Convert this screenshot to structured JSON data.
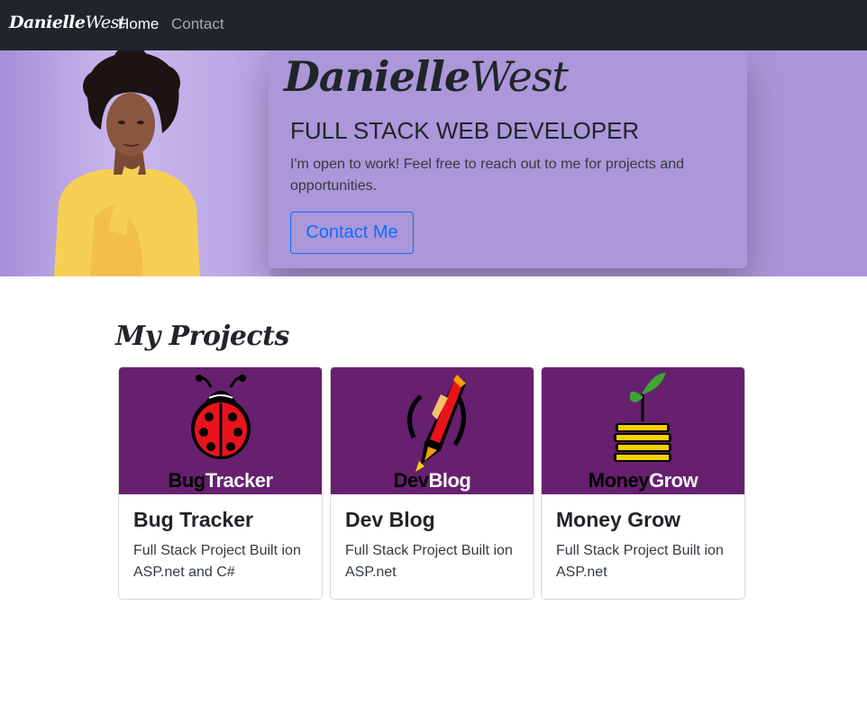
{
  "navbar": {
    "brand_part1": "Danielle",
    "brand_part2": "West",
    "links": [
      {
        "label": "Home",
        "active": true
      },
      {
        "label": "Contact",
        "active": false
      }
    ]
  },
  "hero": {
    "name_part1": "Danielle",
    "name_part2": "West",
    "title": "FULL STACK WEB DEVELOPER",
    "description": "I'm open to work! Feel free to reach out to me for projects and opportunities.",
    "button_label": "Contact Me",
    "background_color": "#a996d8"
  },
  "projects": {
    "heading": "My Projects",
    "cards": [
      {
        "title": "Bug Tracker",
        "description": "Full Stack Project Built ion ASP.net and C#",
        "logo_dark": "Bug",
        "logo_light": "Tracker",
        "icon": "ladybug-icon"
      },
      {
        "title": "Dev Blog",
        "description": "Full Stack Project Built ion ASP.net",
        "logo_dark": "Dev",
        "logo_light": "Blog",
        "icon": "rocket-pencil-icon"
      },
      {
        "title": "Money Grow",
        "description": "Full Stack Project Built ion ASP.net",
        "logo_dark": "Money",
        "logo_light": "Grow",
        "icon": "coin-sprout-icon"
      }
    ]
  },
  "colors": {
    "navbar_bg": "#212529",
    "accent": "#0d6efd",
    "card_image_bg": "#66206e"
  }
}
